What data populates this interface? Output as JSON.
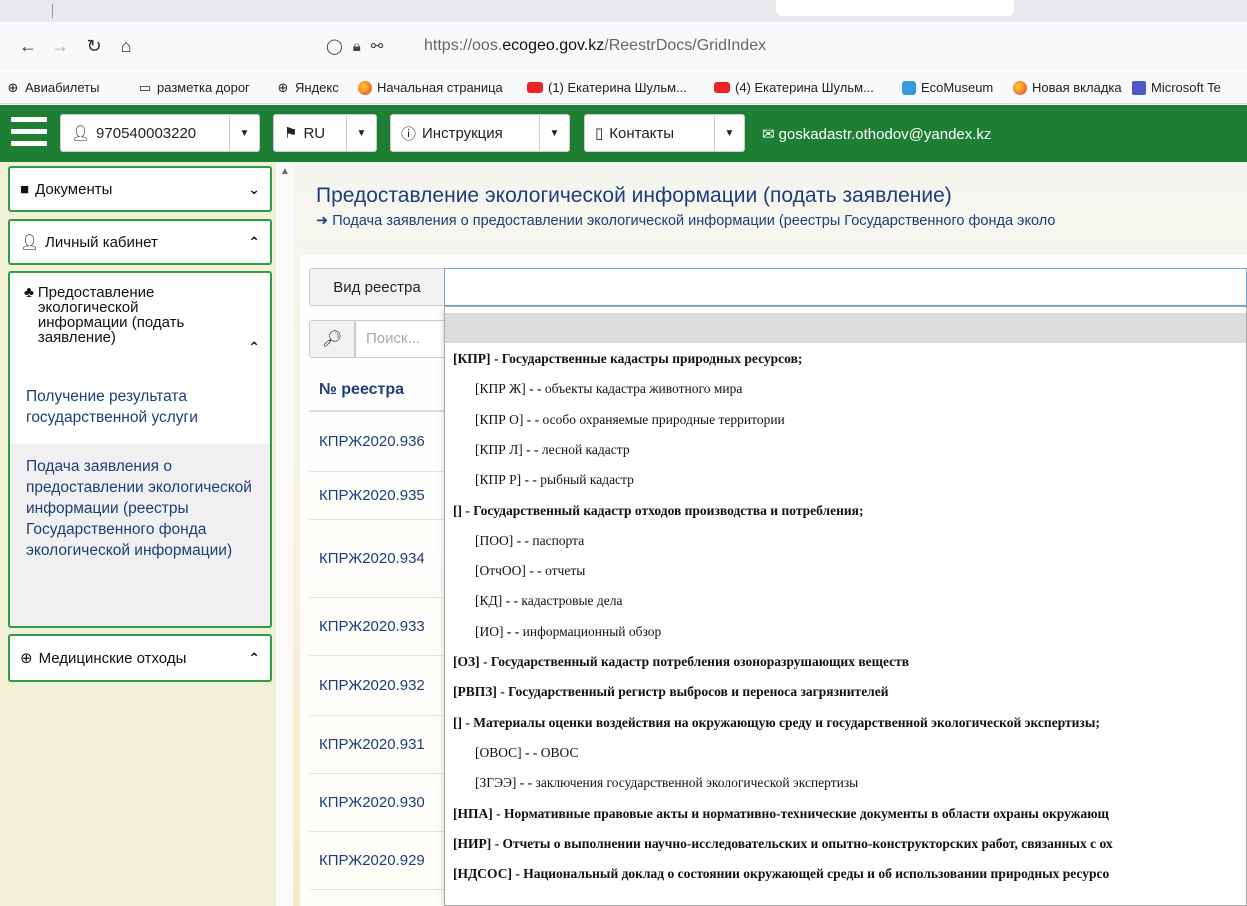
{
  "browser": {
    "url_prefix": "https://oos.",
    "url_domain": "ecogeo.gov.kz",
    "url_path": "/ReestrDocs/GridIndex",
    "bookmarks": [
      {
        "icon": "globe-icon",
        "label": "Авиабилеты"
      },
      {
        "icon": "folder-icon",
        "label": "разметка дорог"
      },
      {
        "icon": "globe-icon",
        "label": "Яндекс"
      },
      {
        "icon": "firefox-icon",
        "label": "Начальная страница"
      },
      {
        "icon": "youtube-icon",
        "label": "(1) Екатерина Шульм..."
      },
      {
        "icon": "youtube-icon",
        "label": "(4) Екатерина Шульм..."
      },
      {
        "icon": "ecomuseum-icon",
        "label": "EcoMuseum"
      },
      {
        "icon": "firefox-icon",
        "label": "Новая вкладка"
      },
      {
        "icon": "teams-icon",
        "label": "Microsoft Te"
      }
    ]
  },
  "header": {
    "user_id": "970540003220",
    "lang": "RU",
    "instruction": "Инструкция",
    "contacts": "Контакты",
    "email": "goskadastr.othodov@yandex.kz"
  },
  "sidebar": {
    "documents": "Документы",
    "cabinet": "Личный кабинет",
    "eco_info": "Предоставление экологической информации (подать заявление)",
    "get_result": "Получение результата государственной услуги",
    "submit_app": "Подача заявления о предоставлении экологической информации (реестры Государственного фонда экологической информации)",
    "medical": "Медицинские отходы"
  },
  "main": {
    "title": "Предоставление экологической информации (подать заявление)",
    "subtitle": "Подача заявления о предоставлении экологической информации (реестры Государственного фонда эколо",
    "registry_label": "Вид реестра",
    "search_placeholder": "Поиск...",
    "col_registry": "№ реестра",
    "rows": [
      "КПРЖ2020.936",
      "КПРЖ2020.935",
      "КПРЖ2020.934",
      "КПРЖ2020.933",
      "КПРЖ2020.932",
      "КПРЖ2020.931",
      "КПРЖ2020.930",
      "КПРЖ2020.929"
    ]
  },
  "dropdown": {
    "options": [
      {
        "code": "[КПР]",
        "text": " - Государственные кадастры природных ресурсов;",
        "level": 1
      },
      {
        "code": "[КПР Ж]",
        "text": " - - объекты кадастра животного мира",
        "level": 2
      },
      {
        "code": "[КПР О]",
        "text": " - - особо охраняемые природные территории",
        "level": 2
      },
      {
        "code": "[КПР Л]",
        "text": " - - лесной кадастр",
        "level": 2
      },
      {
        "code": "[КПР Р]",
        "text": " - - рыбный кадастр",
        "level": 2
      },
      {
        "code": "[]",
        "text": " - Государственный кадастр отходов производства и потребления;",
        "level": 1
      },
      {
        "code": "[ПОО]",
        "text": " - - паспорта",
        "level": 2
      },
      {
        "code": "[ОтчОО]",
        "text": " - - отчеты",
        "level": 2
      },
      {
        "code": "[КД]",
        "text": " - - кадастровые дела",
        "level": 2
      },
      {
        "code": "[ИО]",
        "text": " - - информационный обзор",
        "level": 2
      },
      {
        "code": "[ОЗ]",
        "text": " - Государственный кадастр потребления озоноразрушающих веществ",
        "level": 1
      },
      {
        "code": "[РВПЗ]",
        "text": " - Государственный регистр выбросов и переноса загрязнителей",
        "level": 1
      },
      {
        "code": "[]",
        "text": " - Материалы оценки воздействия на окружающую среду и государственной экологической экспертизы;",
        "level": 1
      },
      {
        "code": "[ОВОС]",
        "text": " - - ОВОС",
        "level": 2
      },
      {
        "code": "[ЗГЭЭ]",
        "text": " - - заключения государственной экологической экспертизы",
        "level": 2
      },
      {
        "code": "[НПА]",
        "text": " - Нормативные правовые акты и нормативно-технические документы в области охраны окружающ",
        "level": 1
      },
      {
        "code": "[НИР]",
        "text": " - Отчеты о выполнении научно-исследовательских и опытно-конструкторских работ, связанных с ох",
        "level": 1
      },
      {
        "code": "[НДСОС]",
        "text": " - Национальный доклад о состоянии окружающей среды и об использовании природных ресурсо",
        "level": 1
      }
    ]
  }
}
